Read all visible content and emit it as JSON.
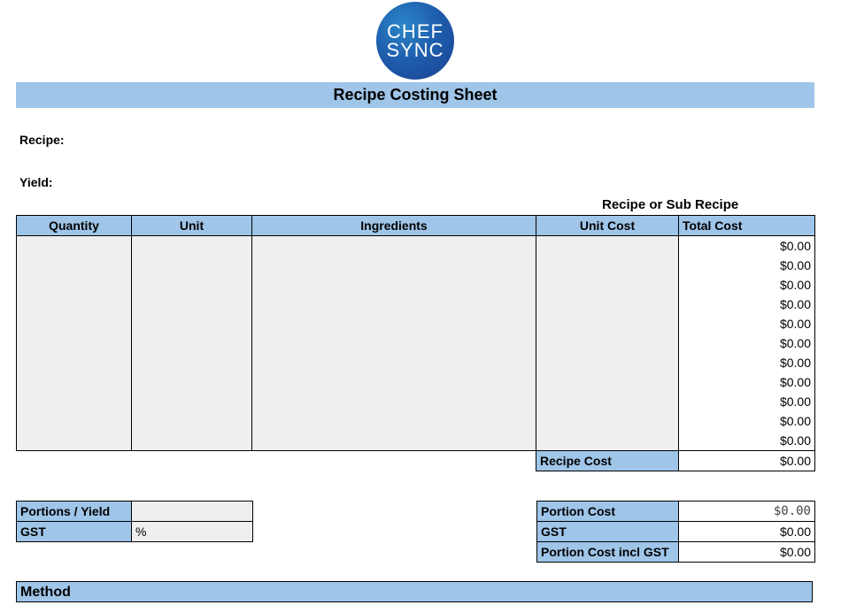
{
  "logo": {
    "line1": "CHEF",
    "line2": "SYNC"
  },
  "title": "Recipe Costing Sheet",
  "recipe_label": "Recipe:",
  "yield_label": "Yield:",
  "recipe_type_label": "Recipe or Sub Recipe",
  "table": {
    "headers": [
      "Quantity",
      "Unit",
      "Ingredients",
      "Unit Cost",
      "Total Cost"
    ],
    "total_costs": [
      "$0.00",
      "$0.00",
      "$0.00",
      "$0.00",
      "$0.00",
      "$0.00",
      "$0.00",
      "$0.00",
      "$0.00",
      "$0.00",
      "$0.00"
    ],
    "recipe_cost_label": "Recipe Cost",
    "recipe_cost_value": "$0.00"
  },
  "left_summary": {
    "portions_label": "Portions / Yield",
    "portions_value": "",
    "gst_label": "GST",
    "gst_value": "%"
  },
  "right_summary": {
    "portion_cost_label": "Portion Cost",
    "portion_cost_value": "$0.00",
    "gst_label": "GST",
    "gst_value": "$0.00",
    "incl_gst_label": "Portion Cost incl GST",
    "incl_gst_value": "$0.00"
  },
  "method_label": "Method",
  "colors": {
    "header_blue": "#9fc5e8",
    "input_grey": "#efefef",
    "logo_blue": "#1f5fae"
  }
}
